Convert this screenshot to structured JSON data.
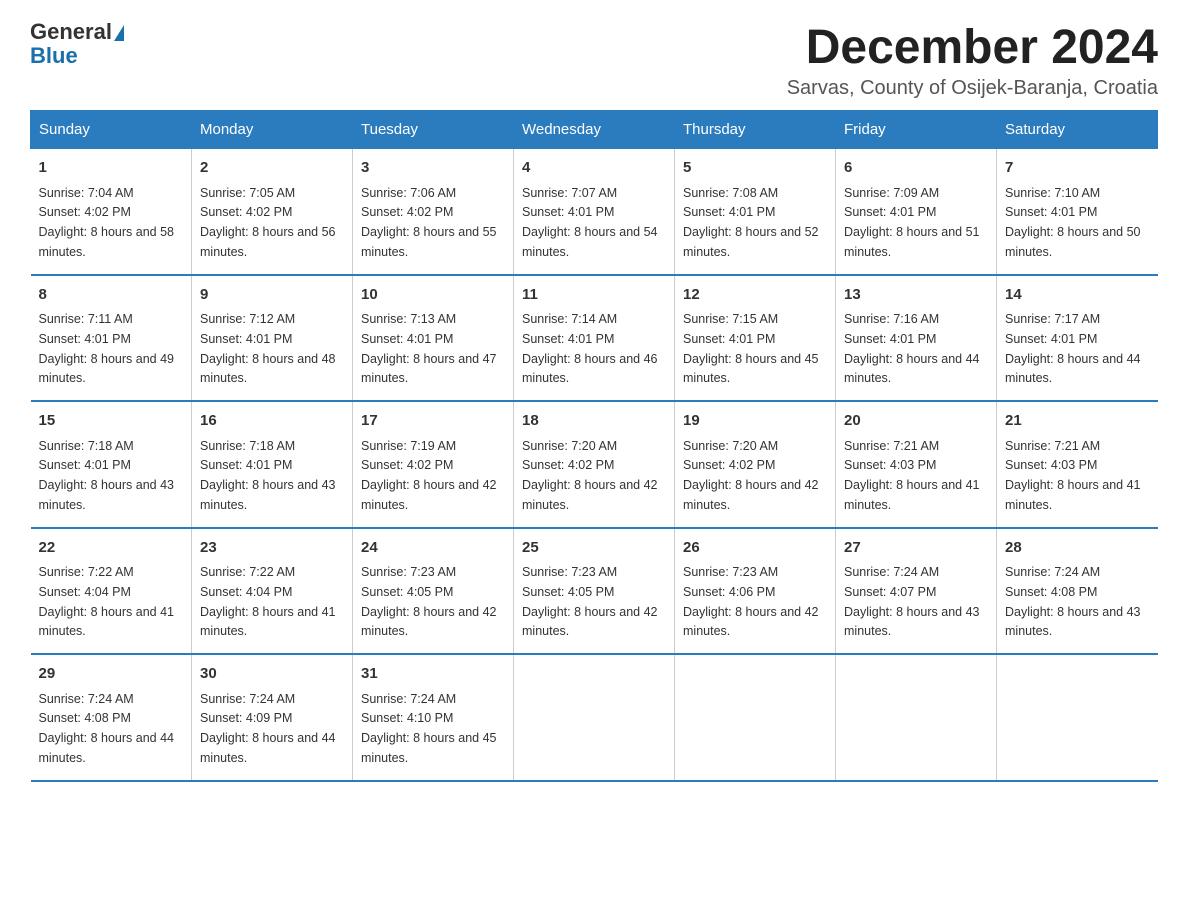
{
  "header": {
    "logo_general": "General",
    "logo_blue": "Blue",
    "month_title": "December 2024",
    "location": "Sarvas, County of Osijek-Baranja, Croatia"
  },
  "days_of_week": [
    "Sunday",
    "Monday",
    "Tuesday",
    "Wednesday",
    "Thursday",
    "Friday",
    "Saturday"
  ],
  "weeks": [
    [
      {
        "day": "1",
        "sunrise": "7:04 AM",
        "sunset": "4:02 PM",
        "daylight": "8 hours and 58 minutes."
      },
      {
        "day": "2",
        "sunrise": "7:05 AM",
        "sunset": "4:02 PM",
        "daylight": "8 hours and 56 minutes."
      },
      {
        "day": "3",
        "sunrise": "7:06 AM",
        "sunset": "4:02 PM",
        "daylight": "8 hours and 55 minutes."
      },
      {
        "day": "4",
        "sunrise": "7:07 AM",
        "sunset": "4:01 PM",
        "daylight": "8 hours and 54 minutes."
      },
      {
        "day": "5",
        "sunrise": "7:08 AM",
        "sunset": "4:01 PM",
        "daylight": "8 hours and 52 minutes."
      },
      {
        "day": "6",
        "sunrise": "7:09 AM",
        "sunset": "4:01 PM",
        "daylight": "8 hours and 51 minutes."
      },
      {
        "day": "7",
        "sunrise": "7:10 AM",
        "sunset": "4:01 PM",
        "daylight": "8 hours and 50 minutes."
      }
    ],
    [
      {
        "day": "8",
        "sunrise": "7:11 AM",
        "sunset": "4:01 PM",
        "daylight": "8 hours and 49 minutes."
      },
      {
        "day": "9",
        "sunrise": "7:12 AM",
        "sunset": "4:01 PM",
        "daylight": "8 hours and 48 minutes."
      },
      {
        "day": "10",
        "sunrise": "7:13 AM",
        "sunset": "4:01 PM",
        "daylight": "8 hours and 47 minutes."
      },
      {
        "day": "11",
        "sunrise": "7:14 AM",
        "sunset": "4:01 PM",
        "daylight": "8 hours and 46 minutes."
      },
      {
        "day": "12",
        "sunrise": "7:15 AM",
        "sunset": "4:01 PM",
        "daylight": "8 hours and 45 minutes."
      },
      {
        "day": "13",
        "sunrise": "7:16 AM",
        "sunset": "4:01 PM",
        "daylight": "8 hours and 44 minutes."
      },
      {
        "day": "14",
        "sunrise": "7:17 AM",
        "sunset": "4:01 PM",
        "daylight": "8 hours and 44 minutes."
      }
    ],
    [
      {
        "day": "15",
        "sunrise": "7:18 AM",
        "sunset": "4:01 PM",
        "daylight": "8 hours and 43 minutes."
      },
      {
        "day": "16",
        "sunrise": "7:18 AM",
        "sunset": "4:01 PM",
        "daylight": "8 hours and 43 minutes."
      },
      {
        "day": "17",
        "sunrise": "7:19 AM",
        "sunset": "4:02 PM",
        "daylight": "8 hours and 42 minutes."
      },
      {
        "day": "18",
        "sunrise": "7:20 AM",
        "sunset": "4:02 PM",
        "daylight": "8 hours and 42 minutes."
      },
      {
        "day": "19",
        "sunrise": "7:20 AM",
        "sunset": "4:02 PM",
        "daylight": "8 hours and 42 minutes."
      },
      {
        "day": "20",
        "sunrise": "7:21 AM",
        "sunset": "4:03 PM",
        "daylight": "8 hours and 41 minutes."
      },
      {
        "day": "21",
        "sunrise": "7:21 AM",
        "sunset": "4:03 PM",
        "daylight": "8 hours and 41 minutes."
      }
    ],
    [
      {
        "day": "22",
        "sunrise": "7:22 AM",
        "sunset": "4:04 PM",
        "daylight": "8 hours and 41 minutes."
      },
      {
        "day": "23",
        "sunrise": "7:22 AM",
        "sunset": "4:04 PM",
        "daylight": "8 hours and 41 minutes."
      },
      {
        "day": "24",
        "sunrise": "7:23 AM",
        "sunset": "4:05 PM",
        "daylight": "8 hours and 42 minutes."
      },
      {
        "day": "25",
        "sunrise": "7:23 AM",
        "sunset": "4:05 PM",
        "daylight": "8 hours and 42 minutes."
      },
      {
        "day": "26",
        "sunrise": "7:23 AM",
        "sunset": "4:06 PM",
        "daylight": "8 hours and 42 minutes."
      },
      {
        "day": "27",
        "sunrise": "7:24 AM",
        "sunset": "4:07 PM",
        "daylight": "8 hours and 43 minutes."
      },
      {
        "day": "28",
        "sunrise": "7:24 AM",
        "sunset": "4:08 PM",
        "daylight": "8 hours and 43 minutes."
      }
    ],
    [
      {
        "day": "29",
        "sunrise": "7:24 AM",
        "sunset": "4:08 PM",
        "daylight": "8 hours and 44 minutes."
      },
      {
        "day": "30",
        "sunrise": "7:24 AM",
        "sunset": "4:09 PM",
        "daylight": "8 hours and 44 minutes."
      },
      {
        "day": "31",
        "sunrise": "7:24 AM",
        "sunset": "4:10 PM",
        "daylight": "8 hours and 45 minutes."
      },
      null,
      null,
      null,
      null
    ]
  ]
}
